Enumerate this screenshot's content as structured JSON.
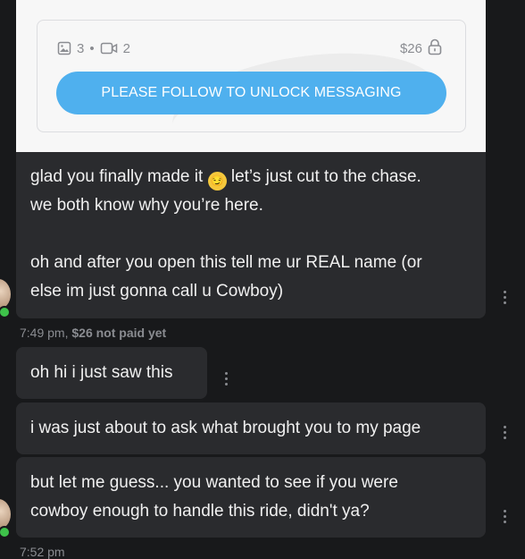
{
  "locked_post": {
    "photo_count": "3",
    "separator": "•",
    "video_count": "2",
    "price": "$26",
    "unlock_button": "PLEASE FOLLOW TO UNLOCK MESSAGING"
  },
  "messages": [
    {
      "line1a": "glad you finally made it",
      "emoji": "smirking-face-emoji",
      "line1b": "let’s just cut to the chase.",
      "line2": "we both know why you’re here.",
      "line3": "oh and after you open this tell me ur REAL name (or",
      "line4": "else im just gonna call u Cowboy)"
    },
    {
      "text": "oh hi i just saw this"
    },
    {
      "text": "i was just about to ask what brought you to my page"
    },
    {
      "line1": "but let me guess... you wanted to see if you were",
      "line2": "cowboy enough to handle this ride, didn't ya?"
    }
  ],
  "meta": {
    "first_time": "7:49 pm,",
    "first_status": "$26 not paid yet",
    "second_time": "7:52 pm"
  },
  "colors": {
    "background": "#18191b",
    "bubble": "#2a2b2e",
    "accent": "#4fb0ee",
    "online": "#3ec24a"
  }
}
